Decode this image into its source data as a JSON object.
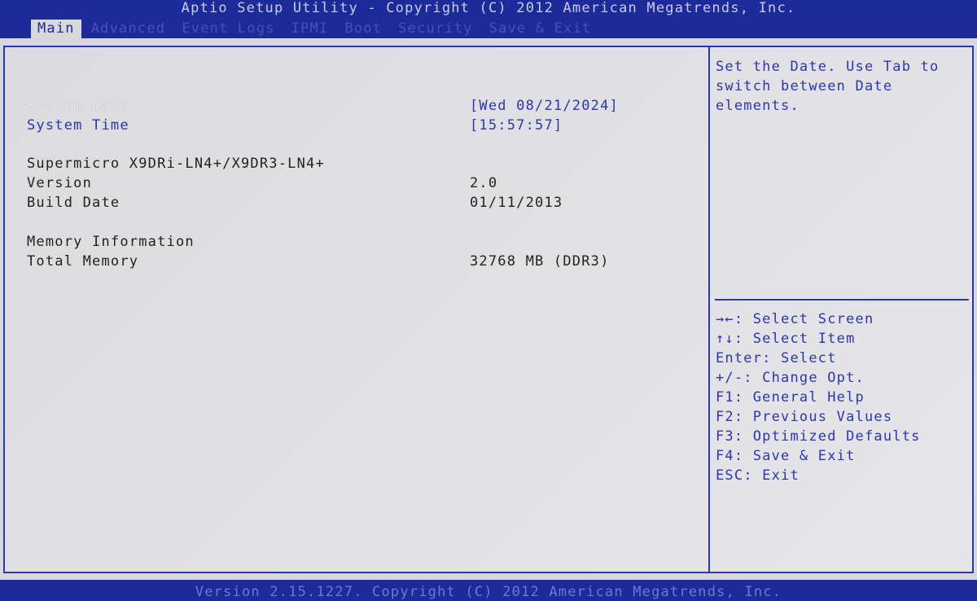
{
  "title": "Aptio Setup Utility - Copyright (C) 2012 American Megatrends, Inc.",
  "tabs": [
    {
      "label": "Main"
    },
    {
      "label": "Advanced"
    },
    {
      "label": "Event Logs"
    },
    {
      "label": "IPMI"
    },
    {
      "label": "Boot"
    },
    {
      "label": "Security"
    },
    {
      "label": "Save & Exit"
    }
  ],
  "main": {
    "system_date_label": "System Date",
    "system_date_value": "[Wed 08/21/2024]",
    "system_time_label": "System Time",
    "system_time_value": "[15:57:57]",
    "board": "Supermicro X9DRi-LN4+/X9DR3-LN4+",
    "version_label": "Version",
    "version_value": "2.0",
    "build_date_label": "Build Date",
    "build_date_value": "01/11/2013",
    "memory_info_label": "Memory Information",
    "total_memory_label": "Total Memory",
    "total_memory_value": "32768 MB (DDR3)"
  },
  "help": {
    "text": "Set the Date. Use Tab to switch between Date elements."
  },
  "keys": [
    {
      "text": "→←: Select Screen"
    },
    {
      "text": "↑↓: Select Item"
    },
    {
      "text": "Enter: Select"
    },
    {
      "text": "+/-: Change Opt."
    },
    {
      "text": "F1: General Help"
    },
    {
      "text": "F2: Previous Values"
    },
    {
      "text": "F3: Optimized Defaults"
    },
    {
      "text": "F4: Save & Exit"
    },
    {
      "text": "ESC: Exit"
    }
  ],
  "footer": "Version 2.15.1227. Copyright (C) 2012 American Megatrends, Inc."
}
